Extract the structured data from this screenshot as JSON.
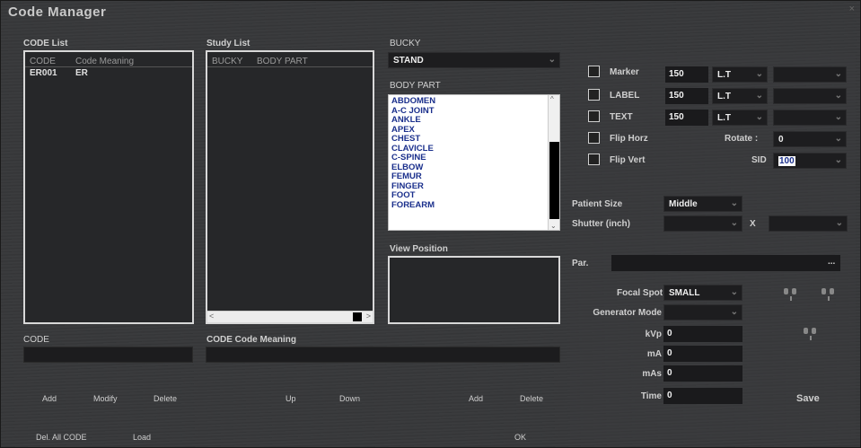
{
  "window": {
    "title": "Code Manager",
    "close": "×"
  },
  "code_list": {
    "label": "CODE List",
    "columns": [
      "CODE",
      "Code Meaning"
    ],
    "rows": [
      {
        "code": "ER001",
        "meaning": "ER"
      }
    ]
  },
  "study_list": {
    "label": "Study List",
    "columns": [
      "BUCKY",
      "BODY PART"
    ],
    "scroll_left": "<",
    "scroll_right": ">"
  },
  "bucky": {
    "label": "BUCKY",
    "value": "STAND",
    "arrow": "⌄"
  },
  "body_part": {
    "label": "BODY PART",
    "items": [
      "ABDOMEN",
      "A-C JOINT",
      "ANKLE",
      "APEX",
      "CHEST",
      "CLAVICLE",
      "C-SPINE",
      "ELBOW",
      "FEMUR",
      "FINGER",
      "FOOT",
      "FOREARM"
    ],
    "scroll_up": "^",
    "scroll_down": "⌄"
  },
  "view_position": {
    "label": "View Position"
  },
  "code_field": {
    "label": "CODE",
    "value": ""
  },
  "code_meaning_field": {
    "label": "CODE Code Meaning",
    "value": ""
  },
  "buttons": {
    "add": "Add",
    "modify": "Modify",
    "delete": "Delete",
    "up": "Up",
    "down": "Down",
    "add2": "Add",
    "delete2": "Delete",
    "del_all": "Del. All CODE",
    "load": "Load",
    "ok": "OK",
    "save": "Save"
  },
  "options": {
    "marker": {
      "label": "Marker",
      "size": "150",
      "pos": "L.T",
      "extra": ""
    },
    "label": {
      "label": "LABEL",
      "size": "150",
      "pos": "L.T",
      "extra": ""
    },
    "text": {
      "label": "TEXT",
      "size": "150",
      "pos": "L.T",
      "extra": ""
    },
    "flip_horz": {
      "label": "Flip Horz"
    },
    "flip_vert": {
      "label": "Flip Vert"
    },
    "rotate": {
      "label": "Rotate :",
      "value": "0"
    },
    "sid": {
      "label": "SID",
      "value": "100"
    }
  },
  "patient": {
    "size_label": "Patient Size",
    "size_value": "Middle",
    "shutter_label": "Shutter  (inch)",
    "shutter_value": "",
    "x_label": "X",
    "x_value": "",
    "par_label": "Par.",
    "par_value": "",
    "par_browse": "..."
  },
  "exposure": {
    "focal_spot_label": "Focal Spot",
    "focal_spot_value": "SMALL",
    "generator_mode_label": "Generator Mode",
    "generator_mode_value": "",
    "kvp_label": "kVp",
    "kvp_value": "0",
    "ma_label": "mA",
    "ma_value": "0",
    "mas_label": "mAs",
    "mas_value": "0",
    "time_label": "Time",
    "time_value": "0"
  }
}
